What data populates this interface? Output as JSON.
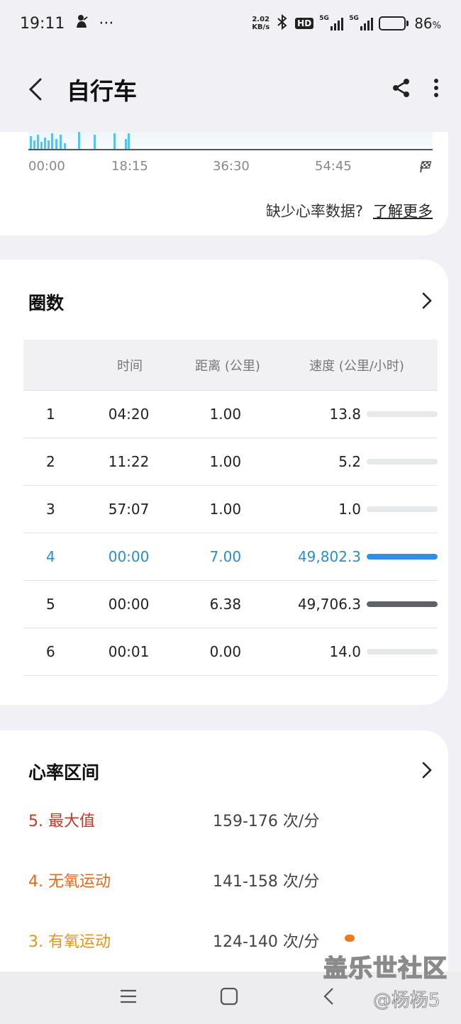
{
  "status_bar": {
    "time": "19:11",
    "more_dots": "···",
    "net_speed_value": "2.02",
    "net_speed_unit": "KB/s",
    "hd_label": "HD",
    "sim1_label": "5G",
    "sim2_label": "5G",
    "battery_percent": "86",
    "battery_unit": "%",
    "battery_level": 0.86
  },
  "app_bar": {
    "title": "自行车",
    "back_icon": "chevron-left-icon",
    "share_icon": "share-icon",
    "menu_icon": "more-vertical-icon"
  },
  "chart_card": {
    "x_ticks": [
      "00:00",
      "18:15",
      "36:30",
      "54:45"
    ],
    "finish_icon": "checkered-flag-icon",
    "missing_hr_text": "缺少心率数据?",
    "learn_more_link": "了解更多",
    "series_color": "#5bc3e6"
  },
  "laps": {
    "title": "圈数",
    "headers": [
      "",
      "时间",
      "距离 (公里)",
      "速度 (公里/小时)"
    ],
    "rows": [
      {
        "num": "1",
        "time": "04:20",
        "distance": "1.00",
        "speed": "13.8",
        "bar_fraction": 0.0,
        "bar_color": "#e6e8ea"
      },
      {
        "num": "2",
        "time": "11:22",
        "distance": "1.00",
        "speed": "5.2",
        "bar_fraction": 0.0,
        "bar_color": "#e6e8ea"
      },
      {
        "num": "3",
        "time": "57:07",
        "distance": "1.00",
        "speed": "1.0",
        "bar_fraction": 0.0,
        "bar_color": "#e6e8ea"
      },
      {
        "num": "4",
        "time": "00:00",
        "distance": "7.00",
        "speed": "49,802.3",
        "bar_fraction": 1.0,
        "bar_color": "#2f8ee6",
        "highlight": true
      },
      {
        "num": "5",
        "time": "00:00",
        "distance": "6.38",
        "speed": "49,706.3",
        "bar_fraction": 1.0,
        "bar_color": "#5f6368"
      },
      {
        "num": "6",
        "time": "00:01",
        "distance": "0.00",
        "speed": "14.0",
        "bar_fraction": 0.0,
        "bar_color": "#e6e8ea"
      }
    ],
    "highlight_color": "#2a8fc8"
  },
  "hr_zones": {
    "title": "心率区间",
    "zones": [
      {
        "name": "5. 最大值",
        "range": "159-176 次/分",
        "color": "#c0392b"
      },
      {
        "name": "4. 无氧运动",
        "range": "141-158 次/分",
        "color": "#e06a1b"
      },
      {
        "name": "3. 有氧运动",
        "range": "124-140 次/分",
        "color": "#e69418"
      }
    ]
  },
  "nav_bar": {
    "recent_icon": "recent-apps-icon",
    "home_icon": "home-icon",
    "back_icon": "back-icon"
  },
  "watermark": {
    "site": "盖乐世社区",
    "user": "@杨杨5"
  }
}
